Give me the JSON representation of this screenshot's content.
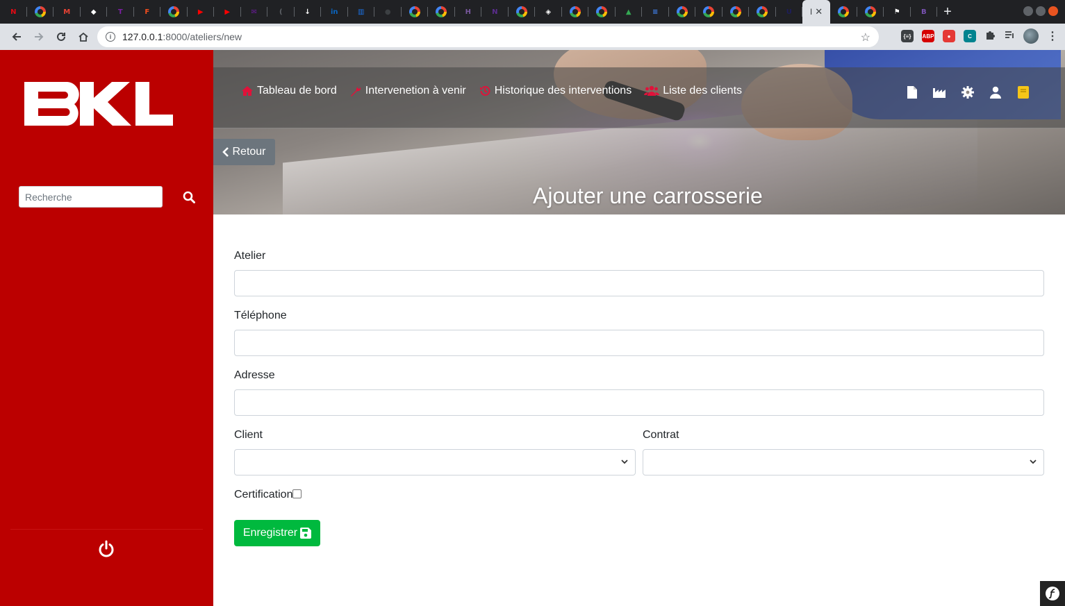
{
  "browser": {
    "url_host": "127.0.0.1",
    "url_path": ":8000/ateliers/new",
    "tabs": [
      {
        "icon": "netflix-icon",
        "color": "#e50914",
        "glyph": "N"
      },
      {
        "icon": "google-icon",
        "color": "g"
      },
      {
        "icon": "gmail-icon",
        "color": "#ea4335",
        "glyph": "M"
      },
      {
        "icon": "diamond-icon",
        "color": "#ffffff",
        "glyph": "◆"
      },
      {
        "icon": "tool-icon",
        "color": "#7b1fa2",
        "glyph": "T"
      },
      {
        "icon": "figma-icon",
        "color": "#f24e1e",
        "glyph": "F"
      },
      {
        "icon": "google-icon",
        "color": "g"
      },
      {
        "icon": "youtube-icon",
        "color": "#ff0000",
        "glyph": "▶"
      },
      {
        "icon": "youtube-icon",
        "color": "#ff0000",
        "glyph": "▶"
      },
      {
        "icon": "mail-icon",
        "color": "#6a1b9a",
        "glyph": "✉"
      },
      {
        "icon": "sound-icon",
        "color": "#5f6368",
        "glyph": "("
      },
      {
        "icon": "download-icon",
        "color": "#ffffff",
        "glyph": "↓"
      },
      {
        "icon": "linkedin-icon",
        "color": "#0a66c2",
        "glyph": "in"
      },
      {
        "icon": "chart-icon",
        "color": "#1a73e8",
        "glyph": "▥"
      },
      {
        "icon": "circle-icon",
        "color": "#3c4043",
        "glyph": "●"
      },
      {
        "icon": "google-icon",
        "color": "g"
      },
      {
        "icon": "google-icon",
        "color": "g"
      },
      {
        "icon": "heroku-icon",
        "color": "#79589f",
        "glyph": "H"
      },
      {
        "icon": "n-icon",
        "color": "#5b2d8e",
        "glyph": "N"
      },
      {
        "icon": "google-icon",
        "color": "g"
      },
      {
        "icon": "codepen-icon",
        "color": "#ffffff",
        "glyph": "◈"
      },
      {
        "icon": "google-icon",
        "color": "g"
      },
      {
        "icon": "google-icon",
        "color": "g"
      },
      {
        "icon": "drive-icon",
        "color": "#34a853",
        "glyph": "▲"
      },
      {
        "icon": "docs-icon",
        "color": "#4285f4",
        "glyph": "≡"
      },
      {
        "icon": "google-icon",
        "color": "g"
      },
      {
        "icon": "google-icon",
        "color": "g"
      },
      {
        "icon": "google-icon",
        "color": "g"
      },
      {
        "icon": "google-icon",
        "color": "g"
      },
      {
        "icon": "terminal-icon",
        "color": "#1e1e5a",
        "glyph": "U"
      }
    ],
    "active_tab_label": "I",
    "tabs_after": [
      {
        "icon": "google-icon",
        "color": "g"
      },
      {
        "icon": "google-icon",
        "color": "g"
      },
      {
        "icon": "flag-icon",
        "color": "#ffffff",
        "glyph": "⚑"
      },
      {
        "icon": "bootstrap-icon",
        "color": "#7952b3",
        "glyph": "B"
      }
    ],
    "extensions": [
      {
        "name": "json-ext-icon",
        "label": "{≡}",
        "color": "#3c4043"
      },
      {
        "name": "adblock-icon",
        "label": "ABP",
        "color": "#d50000"
      },
      {
        "name": "shield-ext-icon",
        "label": "●",
        "color": "#e53935"
      },
      {
        "name": "cookie-ext-icon",
        "label": "C",
        "color": "#00838f"
      }
    ]
  },
  "sidebar": {
    "brand": "BKL",
    "search_placeholder": "Recherche"
  },
  "nav": {
    "links": [
      {
        "label": "Tableau de bord",
        "icon": "home-icon"
      },
      {
        "label": "Intervenetion à venir",
        "icon": "wrench-icon"
      },
      {
        "label": "Historique des interventions",
        "icon": "history-icon"
      },
      {
        "label": "Liste des clients",
        "icon": "users-icon"
      }
    ],
    "accent_color": "#e0123a"
  },
  "hero": {
    "back_label": "Retour",
    "title": "Ajouter une carrosserie"
  },
  "form": {
    "fields": {
      "atelier_label": "Atelier",
      "telephone_label": "Téléphone",
      "adresse_label": "Adresse",
      "client_label": "Client",
      "contrat_label": "Contrat",
      "certification_label": "Certification"
    },
    "values": {
      "atelier": "",
      "telephone": "",
      "adresse": "",
      "client": "",
      "contrat": "",
      "certification": false
    },
    "submit_label": "Enregistrer"
  },
  "colors": {
    "sidebar_bg": "#bb0000",
    "save_button": "#00b93e",
    "back_button": "#6c757d"
  }
}
